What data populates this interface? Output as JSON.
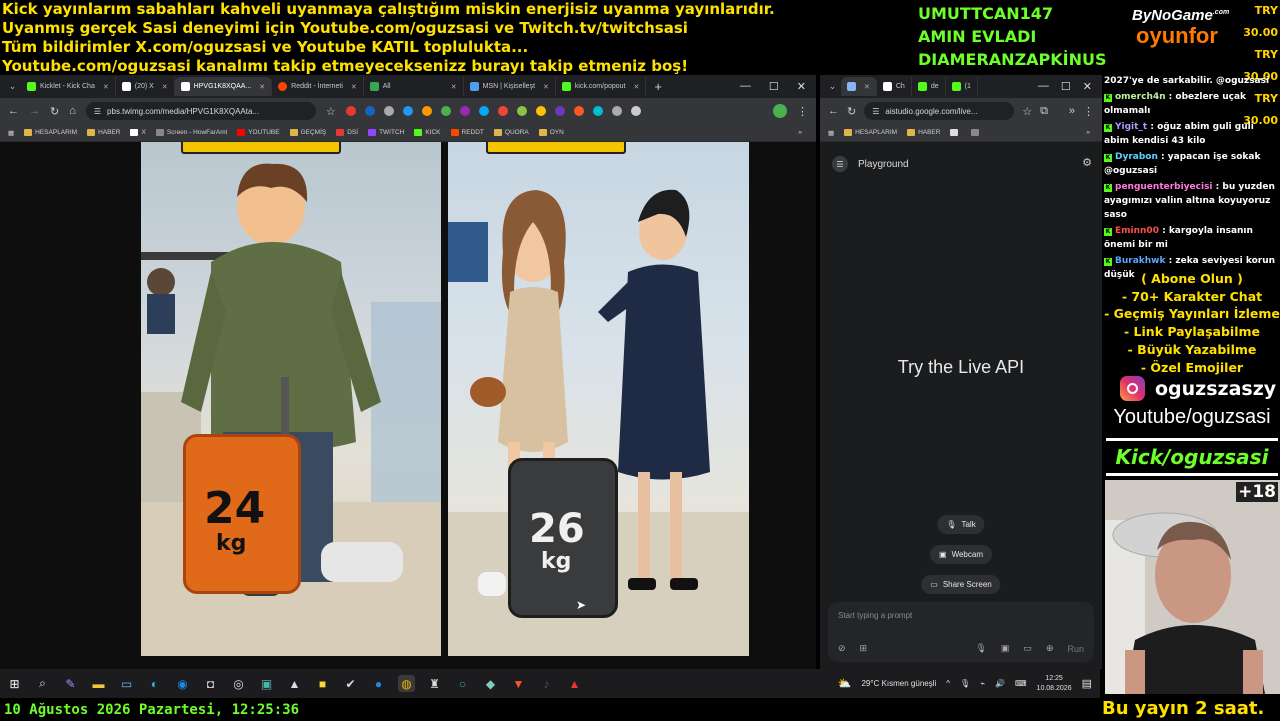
{
  "ticker": [
    "Kick yayınlarım sabahları kahveli uyanmaya çalıştığım miskin enerjisiz uyanma yayınlarıdır.",
    "Uyanmış gerçek Sasi deneyimi için Youtube.com/oguzsasi ve Twitch.tv/twitchsasi",
    "Tüm bildirimler X.com/oguzsasi ve Youtube KATIL toplulukta...",
    "Youtube.com/oguzsasi kanalımı takip etmeyeceksenizz burayı takip etmeniz boş!"
  ],
  "donors": [
    "UMUTTCAN147",
    "AMIN EVLADI",
    "DIAMERANZAPKİNUS"
  ],
  "brand": {
    "line1": "ByNoGame",
    "line1_suffix": ".com",
    "line2": "oyunfor"
  },
  "prices": [
    "TRY 30.00",
    "TRY 30.00",
    "TRY 30.00"
  ],
  "left_browser": {
    "tabs": [
      {
        "label": "Kicklet - Kick Cha",
        "color": "#53fc18"
      },
      {
        "label": "(20) X",
        "color": "#ffffff"
      },
      {
        "label": "HPVG1K8XQAA...",
        "color": "#ffffff"
      },
      {
        "label": "Reddit - İnterneti",
        "color": "#ff4500"
      },
      {
        "label": "All",
        "color": "#34a853"
      },
      {
        "label": "MSN | Kişiselleşt",
        "color": "#4f9cf0"
      },
      {
        "label": "kick.com/popout",
        "color": "#53fc18"
      }
    ],
    "new_tab": "+",
    "url": "pbs.twimg.com/media/HPVG1K8XQAAta...",
    "bookmarks": [
      "HESAPLARIM",
      "HABER",
      "X",
      "Screen - HowFarAml",
      "YOUTUBE",
      "GEÇMİŞ",
      "DSİ",
      "TWITCH",
      "KICK",
      "REDDT",
      "QUORA",
      "OYN"
    ]
  },
  "image": {
    "left_suitcase_weight": "24",
    "left_suitcase_unit": "kg",
    "right_suitcase_weight": "26",
    "right_suitcase_unit": "kg"
  },
  "right_browser": {
    "tabs": [
      {
        "label": "",
        "color": "#8ab4f8"
      },
      {
        "label": "Ch",
        "color": "#ffffff"
      },
      {
        "label": "de",
        "color": "#53fc18"
      },
      {
        "label": "(1",
        "color": "#53fc18"
      }
    ],
    "url": "aistudio.google.com/live...",
    "bookmarks": [
      "HESAPLARIM",
      "HABER"
    ],
    "playground_label": "Playground",
    "headline": "Try the Live API",
    "buttons": [
      "Talk",
      "Webcam",
      "Share Screen"
    ],
    "prompt_placeholder": "Start typing a prompt",
    "run_label": "Run"
  },
  "chat": [
    {
      "user": "",
      "user_color": "#ffffff",
      "text": "2027'ye de sarkabilir. @oguzsasi",
      "mention": ""
    },
    {
      "user": "omerch4n",
      "user_color": "#b9f3a0",
      "text": ": obezlere uçak olmamalı"
    },
    {
      "user": "Yigit_t",
      "user_color": "#a79bff",
      "text": ": oğuz abim guli guli abim kendisi 43 kilo"
    },
    {
      "user": "Dyrabon",
      "user_color": "#5fd3ff",
      "text": ": yapacan işe sokak @oguzsasi"
    },
    {
      "user": "penguenterbiyecisi",
      "user_color": "#ff7bd9",
      "text": ": bu yuzden ayagımızı valiın altına koyuyoruz saso"
    },
    {
      "user": "Eminn00",
      "user_color": "#ff4d4d",
      "text": ": kargoyla insanın önemi bir mi"
    },
    {
      "user": "Burakhwk",
      "user_color": "#5aa8ff",
      "text": ": zeka seviyesi korun düşük"
    }
  ],
  "promo": [
    "( Abone Olun )",
    "- 70+ Karakter Chat",
    "- Geçmiş Yayınları İzleme",
    "- Link Paylaşabilme",
    "- Büyük Yazabilme",
    "- Özel Emojiler"
  ],
  "instagram": "oguzszaszy",
  "youtube_label": "Youtube/oguzsasi",
  "kick_label": "Kick/oguzsasi",
  "cam_badge": "+18",
  "taskbar": {
    "weather": "29°C  Kısmen güneşli",
    "time": "12:25",
    "date": "10.08.2026"
  },
  "footer_date": "10 Ağustos 2026 Pazartesi, 12:25:36",
  "footer_right": "Bu yayın 2 saat."
}
